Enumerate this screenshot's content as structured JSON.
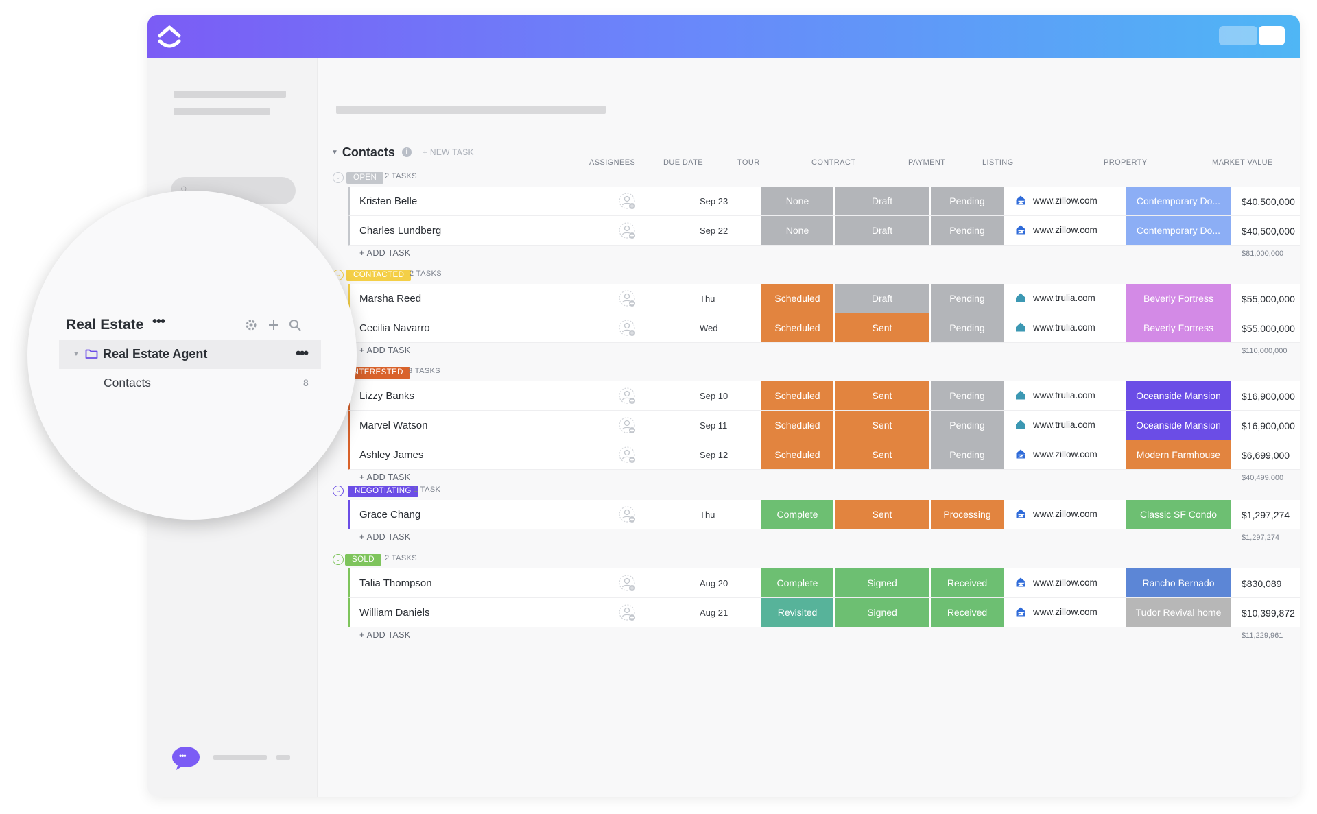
{
  "sidebar": {
    "space_title": "Real Estate",
    "space_more": "•••",
    "folder": {
      "label": "Real Estate Agent",
      "more": "•••"
    },
    "list": {
      "label": "Contacts",
      "count": "8"
    },
    "chat_glyph": "•••"
  },
  "list": {
    "title": "Contacts",
    "new_task": "+ NEW TASK",
    "columns": {
      "assignees": "ASSIGNEES",
      "due_date": "DUE DATE",
      "tour": "TOUR",
      "contract": "CONTRACT",
      "payment": "PAYMENT",
      "listing": "LISTING",
      "property": "PROPERTY",
      "market_value": "MARKET VALUE"
    },
    "add_task": "+ ADD TASK",
    "groups": [
      {
        "status": "OPEN",
        "color": "#c4c7cc",
        "count": "2 TASKS",
        "total": "$81,000,000",
        "rows": [
          {
            "name": "Kristen Belle",
            "due": "Sep 23",
            "tour": "None",
            "contract": "Draft",
            "payment": "Pending",
            "listing": "www.zillow.com",
            "listing_icon": "zillow-icon",
            "property": "Contemporary Do...",
            "property_color": "#8caef5",
            "value": "$40,500,000"
          },
          {
            "name": "Charles Lundberg",
            "due": "Sep 22",
            "tour": "None",
            "contract": "Draft",
            "payment": "Pending",
            "listing": "www.zillow.com",
            "listing_icon": "zillow-icon",
            "property": "Contemporary Do...",
            "property_color": "#8caef5",
            "value": "$40,500,000"
          }
        ]
      },
      {
        "status": "CONTACTED",
        "color": "#f4cf47",
        "count": "2 TASKS",
        "total": "$110,000,000",
        "rows": [
          {
            "name": "Marsha Reed",
            "due": "Thu",
            "tour": "Scheduled",
            "contract": "Draft",
            "payment": "Pending",
            "listing": "www.trulia.com",
            "listing_icon": "trulia-icon",
            "property": "Beverly Fortress",
            "property_color": "#d38ae6",
            "value": "$55,000,000"
          },
          {
            "name": "Cecilia Navarro",
            "due": "Wed",
            "tour": "Scheduled",
            "contract": "Sent",
            "payment": "Pending",
            "listing": "www.trulia.com",
            "listing_icon": "trulia-icon",
            "property": "Beverly Fortress",
            "property_color": "#d38ae6",
            "value": "$55,000,000"
          }
        ]
      },
      {
        "status": "INTERESTED",
        "color": "#d9622b",
        "count": "3 TASKS",
        "total": "$40,499,000",
        "rows": [
          {
            "name": "Lizzy Banks",
            "due": "Sep 10",
            "tour": "Scheduled",
            "contract": "Sent",
            "payment": "Pending",
            "listing": "www.trulia.com",
            "listing_icon": "trulia-icon",
            "property": "Oceanside Mansion",
            "property_color": "#6b4de6",
            "value": "$16,900,000"
          },
          {
            "name": "Marvel Watson",
            "due": "Sep 11",
            "tour": "Scheduled",
            "contract": "Sent",
            "payment": "Pending",
            "listing": "www.trulia.com",
            "listing_icon": "trulia-icon",
            "property": "Oceanside Mansion",
            "property_color": "#6b4de6",
            "value": "$16,900,000"
          },
          {
            "name": "Ashley James",
            "due": "Sep 12",
            "tour": "Scheduled",
            "contract": "Sent",
            "payment": "Pending",
            "listing": "www.zillow.com",
            "listing_icon": "zillow-icon",
            "property": "Modern Farmhouse",
            "property_color": "#e2843f",
            "value": "$6,699,000"
          }
        ]
      },
      {
        "status": "NEGOTIATING",
        "color": "#6b4de6",
        "count": "1 TASK",
        "total": "$1,297,274",
        "rows": [
          {
            "name": "Grace Chang",
            "due": "Thu",
            "tour": "Complete",
            "contract": "Sent",
            "payment": "Processing",
            "listing": "www.zillow.com",
            "listing_icon": "zillow-icon",
            "property": "Classic SF Condo",
            "property_color": "#6dbf72",
            "value": "$1,297,274"
          }
        ]
      },
      {
        "status": "SOLD",
        "color": "#7ec45c",
        "count": "2 TASKS",
        "total": "$11,229,961",
        "rows": [
          {
            "name": "Talia Thompson",
            "due": "Aug 20",
            "tour": "Complete",
            "contract": "Signed",
            "payment": "Received",
            "listing": "www.zillow.com",
            "listing_icon": "zillow-icon",
            "property": "Rancho Bernado",
            "property_color": "#5c86d6",
            "value": "$830,089"
          },
          {
            "name": "William Daniels",
            "due": "Aug 21",
            "tour": "Revisited",
            "contract": "Signed",
            "payment": "Received",
            "listing": "www.zillow.com",
            "listing_icon": "zillow-icon",
            "property": "Tudor Revival home",
            "property_color": "#b7b7b7",
            "value": "$10,399,872"
          }
        ]
      }
    ],
    "label_colors": {
      "None": "#b3b5b9",
      "Draft": "#b3b5b9",
      "Pending": "#b3b5b9",
      "Scheduled": "#e2843f",
      "Sent": "#e2843f",
      "Processing": "#e2843f",
      "Complete": "#6dbf72",
      "Signed": "#6dbf72",
      "Received": "#6dbf72",
      "Revisited": "#57b39a"
    }
  }
}
